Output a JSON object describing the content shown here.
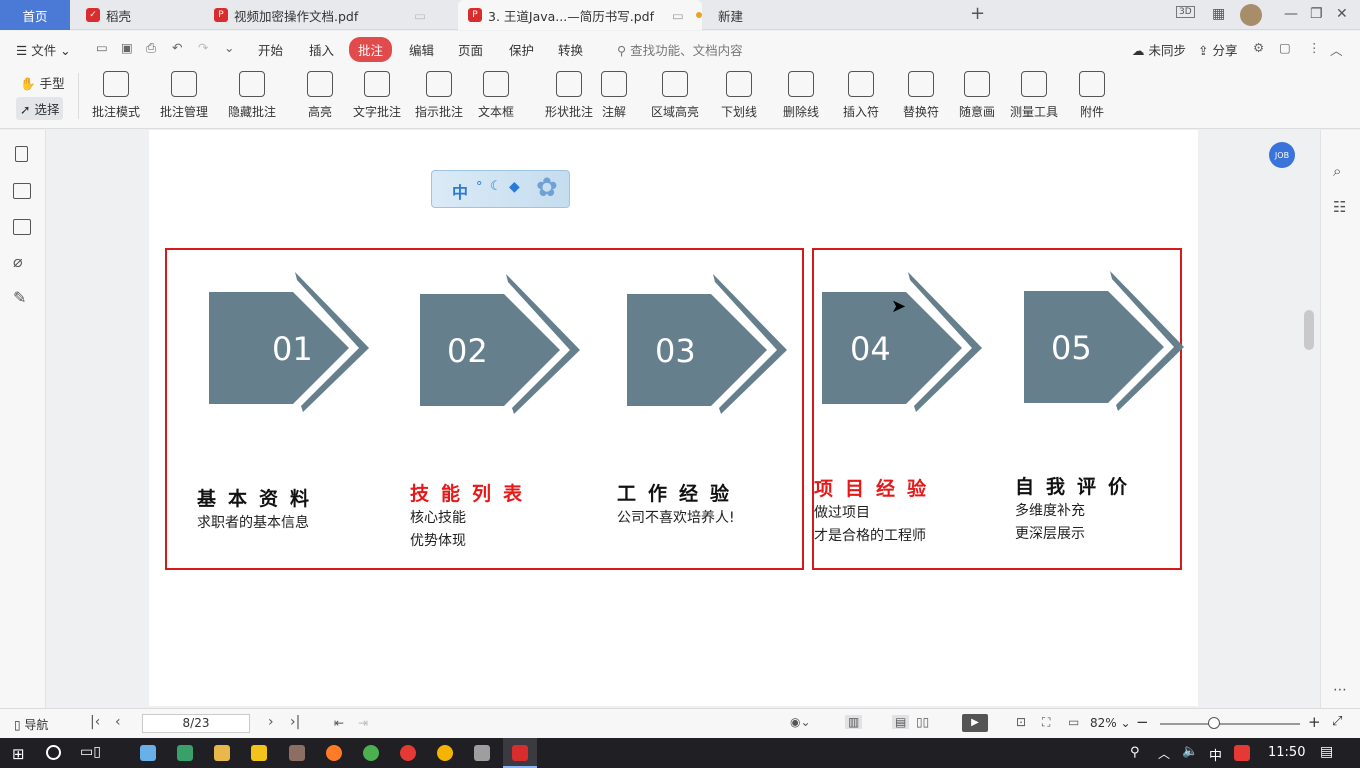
{
  "tabs": {
    "home": "首页",
    "t1": "稻壳",
    "t2": "视频加密操作文档.pdf",
    "t3": "3. 王道Java...—简历书写.pdf",
    "t4": "新建"
  },
  "menu": {
    "file": "文件",
    "items": [
      "开始",
      "插入",
      "批注",
      "编辑",
      "页面",
      "保护",
      "转换"
    ],
    "search": "查找功能、文档内容",
    "sync": "未同步",
    "share": "分享"
  },
  "ribbon": {
    "hand": "手型",
    "select": "选择",
    "buttons": [
      "批注模式",
      "批注管理",
      "隐藏批注",
      "高亮",
      "文字批注",
      "指示批注",
      "文本框",
      "形状批注",
      "注解",
      "区域高亮",
      "下划线",
      "删除线",
      "插入符",
      "替换符",
      "随意画",
      "测量工具",
      "附件"
    ]
  },
  "badge": {
    "text": "中"
  },
  "sections": [
    {
      "num": "01",
      "title": "基本资料",
      "lines": [
        "求职者的基本信息"
      ],
      "red": false
    },
    {
      "num": "02",
      "title": "技能列表",
      "lines": [
        "核心技能",
        "优势体现"
      ],
      "red": true
    },
    {
      "num": "03",
      "title": "工作经验",
      "lines": [
        "公司不喜欢培养人!"
      ],
      "red": false
    },
    {
      "num": "04",
      "title": "项目经验",
      "lines": [
        "做过项目",
        "才是合格的工程师"
      ],
      "red": true
    },
    {
      "num": "05",
      "title": "自我评价",
      "lines": [
        "多维度补充",
        "更深层展示"
      ],
      "red": false
    }
  ],
  "status": {
    "nav": "导航",
    "page": "8/23",
    "zoom": "82%"
  },
  "taskbar": {
    "ime": "中",
    "time": "11:50"
  },
  "colors": {
    "arrow": "#657f8d",
    "red": "#d51a1a",
    "accent": "#4a7ad6"
  }
}
